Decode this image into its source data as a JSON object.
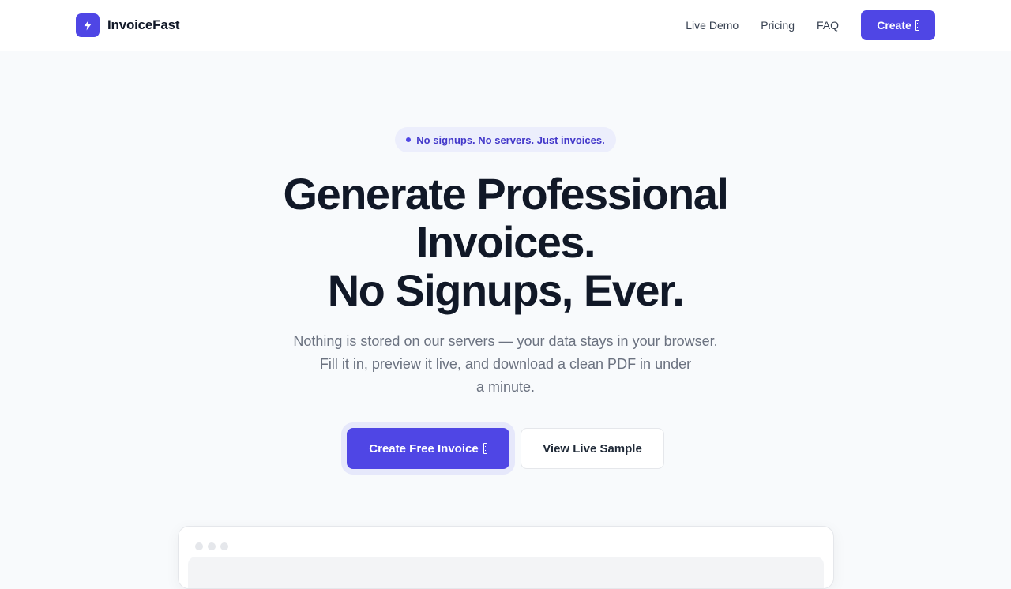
{
  "brand": {
    "name": "InvoiceFast",
    "logo_icon": "lightning-bolt-icon",
    "accent": "#4f46e5"
  },
  "nav": {
    "links": [
      "Live Demo",
      "Pricing",
      "FAQ"
    ],
    "create_label": "Create"
  },
  "hero": {
    "badge": "No signups. No servers. Just invoices.",
    "headline_lines": [
      "Generate Professional",
      "Invoices.",
      "No Signups, Ever."
    ],
    "subtext_lines": [
      "Nothing is stored on our servers — your data stays in your browser.",
      "Fill it in, preview it live, and download a clean PDF in under",
      "a minute."
    ],
    "primary_cta": "Create Free Invoice",
    "secondary_cta": "View Live Sample"
  },
  "colors": {
    "background": "#f8fafc",
    "text": "#111827",
    "muted": "#6b7280"
  }
}
